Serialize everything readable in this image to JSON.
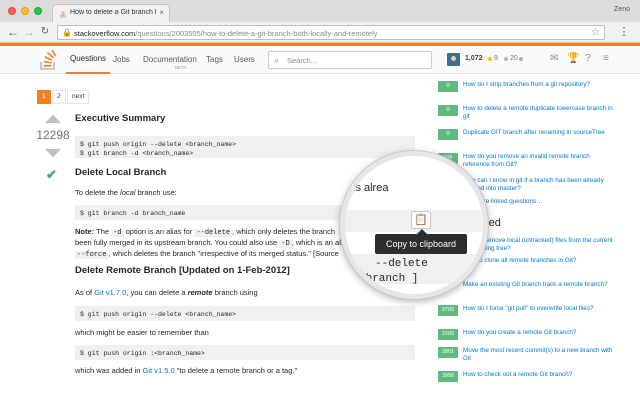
{
  "browser": {
    "tab_title": "How to delete a Git branch bo",
    "tab_close": "×",
    "profile_name": "Zeno",
    "url_domain": "stackoverflow.com",
    "url_path": "/questions/2003505/how-to-delete-a-git-branch-both-locally-and-remotely",
    "nav_back": "←",
    "nav_forward": "→",
    "nav_reload": "↻",
    "lock_icon": "🔒",
    "star_icon": "☆",
    "menu_icon": "⋮"
  },
  "topbar": {
    "nav": {
      "questions": "Questions",
      "jobs": "Jobs",
      "documentation": "Documentation",
      "documentation_badge": "BETA",
      "tags": "Tags",
      "users": "Users"
    },
    "search_placeholder": "Search...",
    "search_icon": "⌕",
    "reputation": "1,072",
    "gold_badges": "9",
    "silver_badges": "20",
    "inbox_icon": "✉",
    "achievements_icon": "🏆",
    "help_icon": "?",
    "hamburger_icon": "≡",
    "accent_color": "#f48024"
  },
  "pagination": {
    "page_1": "1",
    "page_2": "2",
    "next": "next"
  },
  "answer": {
    "vote_count": "12298",
    "accepted_icon": "✔",
    "sections": {
      "exec_summary_title": "Executive Summary",
      "exec_code": "$ git push origin --delete <branch_name>\n$ git branch -d <branch_name>",
      "delete_local_title": "Delete Local Branch",
      "delete_local_intro_pre": "To delete the ",
      "delete_local_intro_em": "local",
      "delete_local_intro_post": " branch use:",
      "delete_local_code": "$ git branch -d branch_name",
      "note_label": "Note:",
      "note_line1_a": " The ",
      "note_line1_code1": "-d",
      "note_line1_b": " option is an alias for ",
      "note_line1_code2": "--delete",
      "note_line1_c": ", which only deletes the branch",
      "note_line2": "been fully merged in its upstream branch. You could also use ",
      "note_line2_code": "-D",
      "note_line2_b": ", which is an alias fo",
      "note_line3_code": "--force",
      "note_line3_b": ", which deletes the branch \"irrespective of its merged status.\" [Source",
      "delete_remote_title": "Delete Remote Branch [Updated on 1-Feb-2012]",
      "as_of_pre": "As of ",
      "as_of_link": "Git v1.7.0",
      "as_of_mid": ", you can delete a ",
      "as_of_em": "remote",
      "as_of_post": " branch using",
      "remote_code1": "$ git push origin --delete <branch_name>",
      "easier_text": "which might be easier to remember than",
      "remote_code2": "$ git push origin :<branch_name>",
      "added_pre": "which was added in ",
      "added_link": "Git v1.5.0",
      "added_post": " \"to delete a remote branch or a tag.\""
    }
  },
  "sidebar": {
    "items": [
      {
        "score": "0",
        "title": "How do I strip branches from a git repository?"
      },
      {
        "score": "0",
        "title": "How to delete a remote duplicate lowercase branch in git"
      },
      {
        "score": "0",
        "title": "Duplicate GIT branch after renaming in sourceTree"
      },
      {
        "score": "296",
        "title": "How do you remove an invalid remote branch reference from Git?"
      },
      {
        "score": "",
        "title": "How can I know in git if a branch has been already merged into master?"
      },
      {
        "score": "",
        "title": "see more linked questions…"
      },
      {
        "score": "",
        "title": "Related"
      },
      {
        "score": "",
        "title": "How to remove local (untracked) files from the current Git working tree?"
      },
      {
        "score": "445",
        "title": "How to clone all remote branches in Git?"
      },
      {
        "score": "",
        "title": "Make an existing Git branch track a remote branch?"
      },
      {
        "score": "3709",
        "title": "How do I force \"git pull\" to overwrite local files?"
      },
      {
        "score": "2205",
        "title": "How do you create a remote Git branch?"
      },
      {
        "score": "2801",
        "title": "Move the most recent commit(s) to a new branch with Git"
      },
      {
        "score": "3956",
        "title": "How to check out a remote Git branch?"
      }
    ],
    "badge_color": "#5fba7d",
    "link_color": "#0077cc"
  },
  "magnifier": {
    "visible_text_1": "is alrea",
    "visible_code_1": "--delete",
    "visible_code_2": "-branch ]",
    "clipboard_icon": "📋",
    "tooltip": "Copy to clipboard"
  }
}
